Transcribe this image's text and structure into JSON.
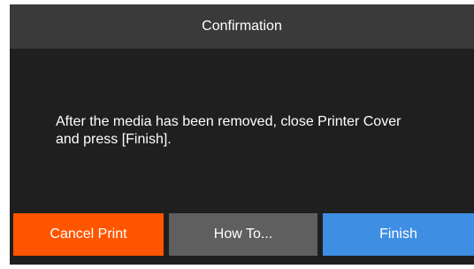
{
  "dialog": {
    "title": "Confirmation",
    "message": "After the media has been removed, close Printer Cover\nand press [Finish]."
  },
  "buttons": {
    "cancel_label": "Cancel Print",
    "howto_label": "How To...",
    "finish_label": "Finish"
  },
  "colors": {
    "title_bar": "#3a3a3a",
    "background": "#1f1f1f",
    "cancel": "#ff5500",
    "howto": "#5f5f5f",
    "finish": "#3e8ee4"
  }
}
